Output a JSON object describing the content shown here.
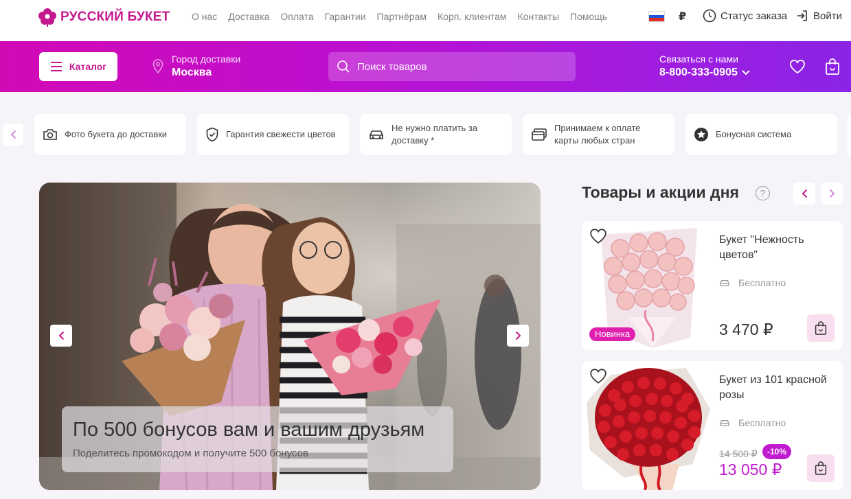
{
  "brand": {
    "name": "РУССКИЙ БУКЕТ",
    "accent": "#c4198e"
  },
  "topnav": [
    "О нас",
    "Доставка",
    "Оплата",
    "Гарантии",
    "Партнёрам",
    "Корп. клиентам",
    "Контакты",
    "Помощь"
  ],
  "topbar": {
    "currency": "₽",
    "order_status": "Статус заказа",
    "login": "Войти"
  },
  "header": {
    "catalog": "Каталог",
    "city_label": "Город доставки",
    "city_value": "Москва",
    "search_placeholder": "Поиск товаров",
    "contact_label": "Связаться с нами",
    "contact_phone": "8-800-333-0905"
  },
  "benefits": [
    {
      "icon": "camera-icon",
      "text": "Фото букета до доставки"
    },
    {
      "icon": "shield-check-icon",
      "text": "Гарантия свежести цветов"
    },
    {
      "icon": "car-icon",
      "text": "Не нужно платить за доставку *"
    },
    {
      "icon": "credit-card-icon",
      "text": "Принимаем к оплате карты любых стран"
    },
    {
      "icon": "star-badge-icon",
      "text": "Бонусная система"
    }
  ],
  "hero": {
    "title": "По 500 бонусов вам и вашим друзьям",
    "subtitle": "Поделитесь промокодом и получите 500 бонусов"
  },
  "products_section": {
    "title": "Товары и акции дня",
    "help": "?"
  },
  "products": [
    {
      "name": "Букет \"Нежность цветов\"",
      "delivery": "Бесплатно",
      "price": "3 470 ₽",
      "badge": "Новинка"
    },
    {
      "name": "Букет из 101 красной розы",
      "delivery": "Бесплатно",
      "old_price": "14 500 ₽",
      "discount": "-10%",
      "price": "13 050 ₽"
    }
  ]
}
